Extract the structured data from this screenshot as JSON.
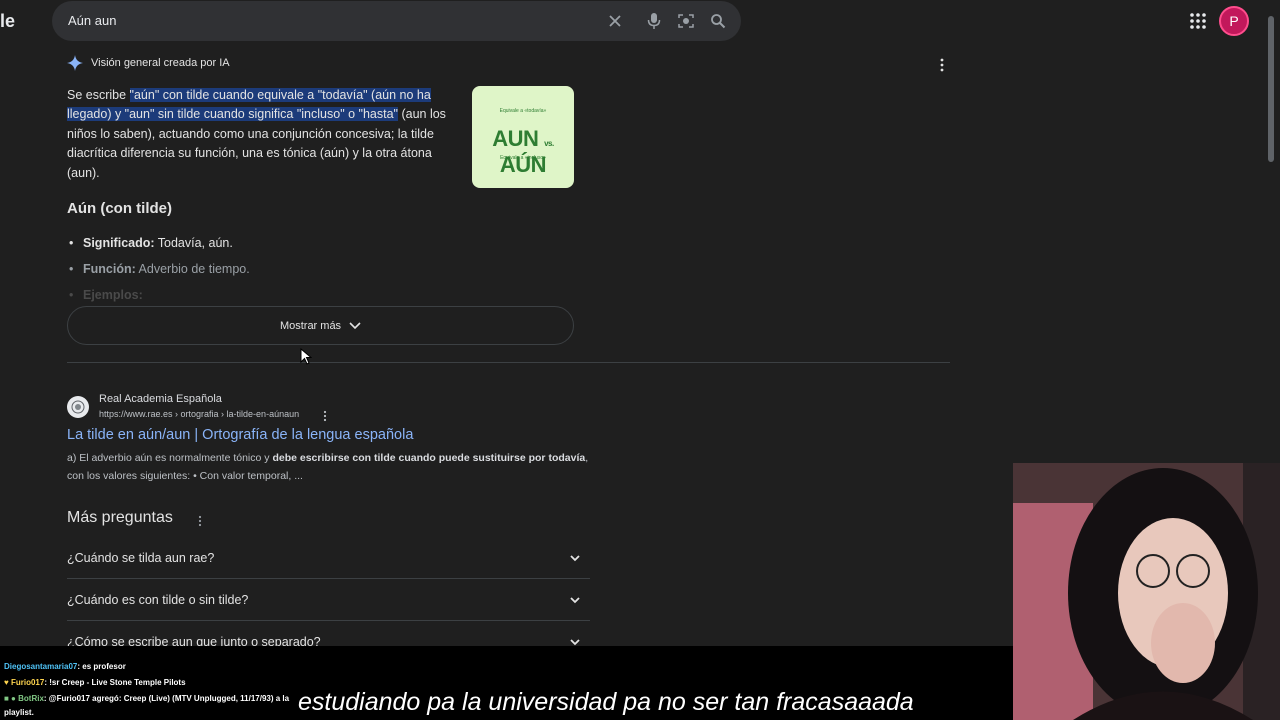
{
  "browser": {
    "logo_fragment": "le",
    "search_query": "Aún aun",
    "account_initial": "P"
  },
  "ai_overview": {
    "header": "Visión general creada por IA",
    "highlighted_text": "\"aún\" con tilde cuando equivale a \"todavía\" (aún no ha llegado) y \"aun\" sin tilde cuando significa \"incluso\" o \"hasta\"",
    "text_before": "Se escribe ",
    "text_after": " (aun los niños lo saben), actuando como una conjunción concesiva; la tilde diacrítica diferencia su función, una es tónica (aún) y la otra átona (aun).",
    "thumbnail": {
      "top_text": "Equivale a «todavía»",
      "left_word": "AUN",
      "middle": "vs.",
      "right_word": "AÚN",
      "bottom_text": "Equivale a «incluso»"
    },
    "subheading": "Aún (con tilde)",
    "bullets": [
      {
        "label": "Significado:",
        "text": " Todavía, aún."
      },
      {
        "label": "Función:",
        "text": " Adverbio de tiempo."
      },
      {
        "label": "Ejemplos:",
        "text": ""
      }
    ],
    "show_more": "Mostrar más"
  },
  "result": {
    "site_name": "Real Academia Española",
    "url": "https://www.rae.es › ortografia › la-tilde-en-aúnaun",
    "title": "La tilde en aún/aun | Ortografía de la lengua española",
    "snippet_1": "a) El adverbio aún es normalmente tónico y ",
    "snippet_bold_1": "debe escribirse con tilde cuando puede sustituirse por",
    "snippet_bold_2": "todavía",
    "snippet_2": ", con los valores siguientes: • Con valor temporal, ..."
  },
  "people_also_ask": {
    "title": "Más preguntas",
    "questions": [
      "¿Cuándo se tilda aun rae?",
      "¿Cuándo es con tilde o sin tilde?",
      "¿Cómo se escribe aun que junto o separado?"
    ]
  },
  "stream": {
    "chat": [
      {
        "user": "Diegosantamaria07",
        "message": ": es profesor",
        "color": "#4fc3f7"
      },
      {
        "user": "Furio017",
        "message": ": !sr Creep - Live Stone Temple Pilots",
        "color": "#ffd54f"
      },
      {
        "user": "BotRix",
        "message": ": @Furio017 agregó: Creep (Live) (MTV Unplugged, 11/17/93) a la",
        "color": "#81c784"
      },
      {
        "user": "",
        "message": "playlist.",
        "color": "#ffffff"
      }
    ],
    "caption": "estudiando pa la universidad pa no ser tan fracasaaada"
  },
  "colors": {
    "background": "#1f1f1f",
    "link": "#8ab4f8",
    "highlight": "#1c3b7a",
    "avatar": "#c2185b"
  }
}
